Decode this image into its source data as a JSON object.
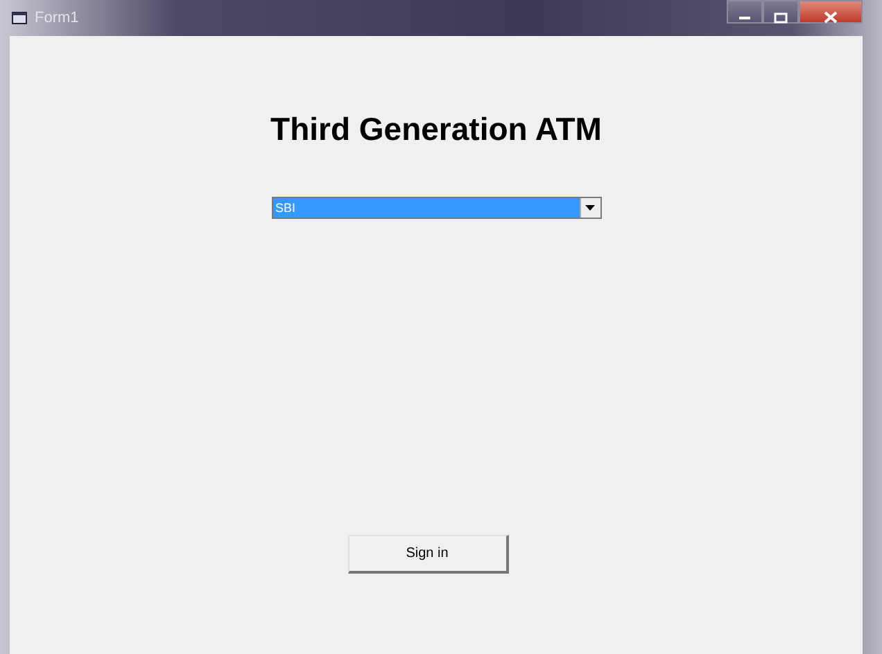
{
  "window": {
    "title": "Form1"
  },
  "heading": "Third Generation ATM",
  "bank_select": {
    "value": "SBI",
    "selected": true
  },
  "buttons": [
    "Sign in"
  ]
}
